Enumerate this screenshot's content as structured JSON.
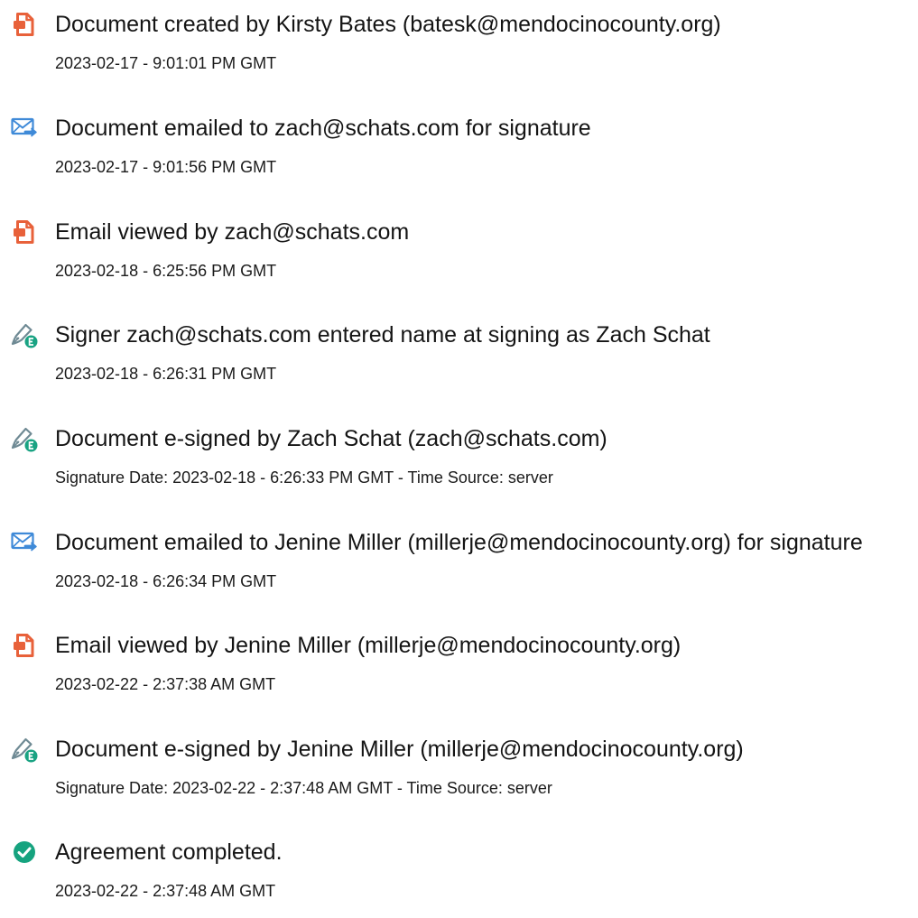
{
  "colors": {
    "document_icon": "#e8613a",
    "email_icon": "#3f8ad8",
    "sign_icon_pen": "#6f8a94",
    "sign_icon_badge": "#1aa383",
    "completed_icon": "#16a37f"
  },
  "events": [
    {
      "icon": "document-icon",
      "title": "Document created by Kirsty Bates (batesk@mendocinocounty.org)",
      "detail": "2023-02-17 - 9:01:01 PM GMT"
    },
    {
      "icon": "email-send-icon",
      "title": "Document emailed to zach@schats.com for signature",
      "detail": "2023-02-17 - 9:01:56 PM GMT"
    },
    {
      "icon": "document-icon",
      "title": "Email viewed by zach@schats.com",
      "detail": "2023-02-18 - 6:25:56 PM GMT"
    },
    {
      "icon": "e-sign-pen-icon",
      "title": "Signer zach@schats.com entered name at signing as Zach Schat",
      "detail": "2023-02-18 - 6:26:31 PM GMT"
    },
    {
      "icon": "e-sign-pen-icon",
      "title": "Document e-signed by Zach Schat (zach@schats.com)",
      "detail": "Signature Date: 2023-02-18 - 6:26:33 PM GMT - Time Source: server"
    },
    {
      "icon": "email-send-icon",
      "title": "Document emailed to Jenine Miller (millerje@mendocinocounty.org) for signature",
      "detail": "2023-02-18 - 6:26:34 PM GMT"
    },
    {
      "icon": "document-icon",
      "title": "Email viewed by Jenine Miller (millerje@mendocinocounty.org)",
      "detail": "2023-02-22 - 2:37:38 AM GMT"
    },
    {
      "icon": "e-sign-pen-icon",
      "title": "Document e-signed by Jenine Miller (millerje@mendocinocounty.org)",
      "detail": "Signature Date: 2023-02-22 - 2:37:48 AM GMT - Time Source: server"
    },
    {
      "icon": "check-circle-icon",
      "title": "Agreement completed.",
      "detail": "2023-02-22 - 2:37:48 AM GMT"
    }
  ]
}
